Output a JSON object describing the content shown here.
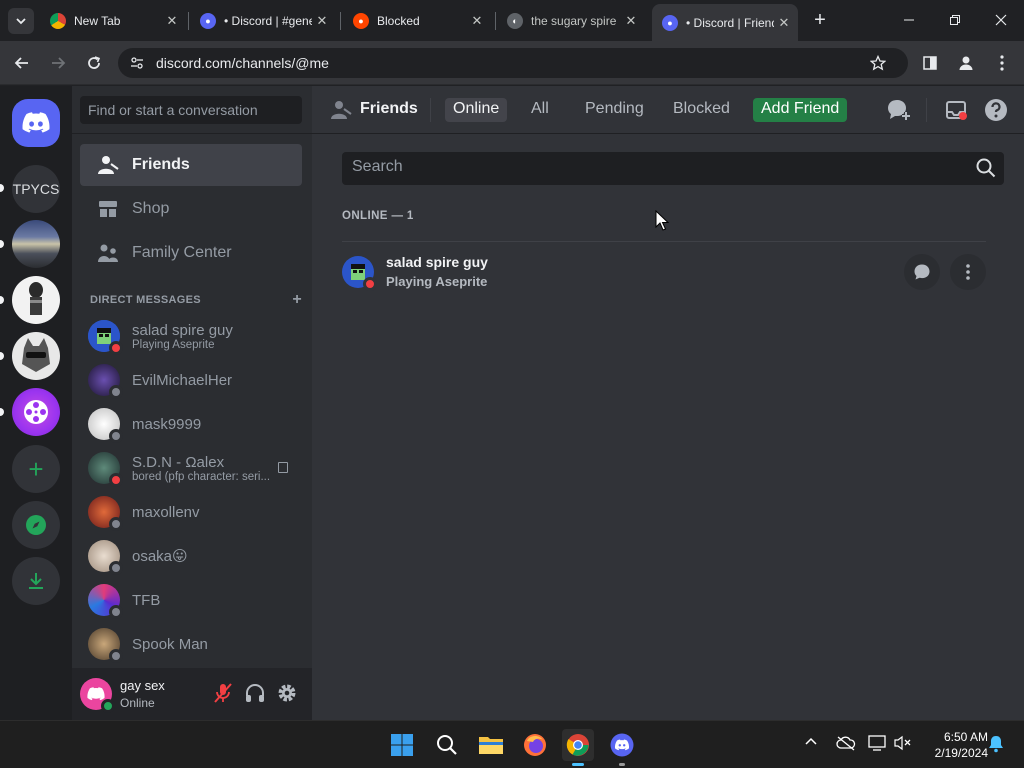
{
  "browser": {
    "tabs": [
      {
        "title": "New Tab",
        "active": false
      },
      {
        "title": "• Discord | #general",
        "active": false
      },
      {
        "title": "Blocked",
        "active": false
      },
      {
        "title": "the sugary spire",
        "active": false
      },
      {
        "title": "• Discord | Friends",
        "active": true
      }
    ],
    "new_tab_label": "+",
    "url": "discord.com/channels/@me"
  },
  "guilds": {
    "items": [
      {
        "name": "home-button"
      },
      {
        "label": "TPYCS"
      },
      {
        "name": "server-landscape"
      },
      {
        "name": "server-character"
      },
      {
        "name": "server-cat"
      },
      {
        "name": "server-film"
      }
    ],
    "add_label": "+"
  },
  "sidebar": {
    "search_placeholder": "Find or start a conversation",
    "nav": [
      {
        "label": "Friends",
        "icon": "friends-icon",
        "selected": true
      },
      {
        "label": "Shop",
        "icon": "shop-icon",
        "selected": false
      },
      {
        "label": "Family Center",
        "icon": "family-icon",
        "selected": false
      }
    ],
    "dm_header": "DIRECT MESSAGES",
    "dm_add": "+",
    "dms": [
      {
        "name": "salad spire guy",
        "sub": "Playing Aseprite",
        "status": "dnd",
        "color": "#2b55c9"
      },
      {
        "name": "EvilMichaelHer",
        "sub": "",
        "status": "off",
        "color": "#3b2a5c"
      },
      {
        "name": "mask9999",
        "sub": "",
        "status": "off",
        "color": "#d9d9d9"
      },
      {
        "name": "S.D.N - Ωalex",
        "sub": "bored (pfp character: seri...",
        "status": "dnd",
        "color": "#2e4a4a"
      },
      {
        "name": "maxollenv",
        "sub": "",
        "status": "off",
        "color": "#b5432b"
      },
      {
        "name": "osaka😛",
        "sub": "",
        "status": "off",
        "color": "#c7b8a8"
      },
      {
        "name": "TFB",
        "sub": "",
        "status": "off",
        "color": "#6a2fb0"
      },
      {
        "name": "Spook Man",
        "sub": "",
        "status": "off",
        "color": "#8a6a4a"
      }
    ]
  },
  "user": {
    "name": "gay sex",
    "status": "Online"
  },
  "header": {
    "title": "Friends",
    "tabs": [
      "Online",
      "All",
      "Pending",
      "Blocked"
    ],
    "add_friend": "Add Friend"
  },
  "main": {
    "search_placeholder": "Search",
    "online_header": "ONLINE — 1",
    "friends": [
      {
        "name": "salad spire guy",
        "activity": "Playing Aseprite",
        "status": "dnd"
      }
    ]
  },
  "taskbar": {
    "time": "6:50 AM",
    "date": "2/19/2024"
  },
  "colors": {
    "accent": "#5865f2",
    "green": "#248046",
    "dnd": "#f23f43"
  }
}
